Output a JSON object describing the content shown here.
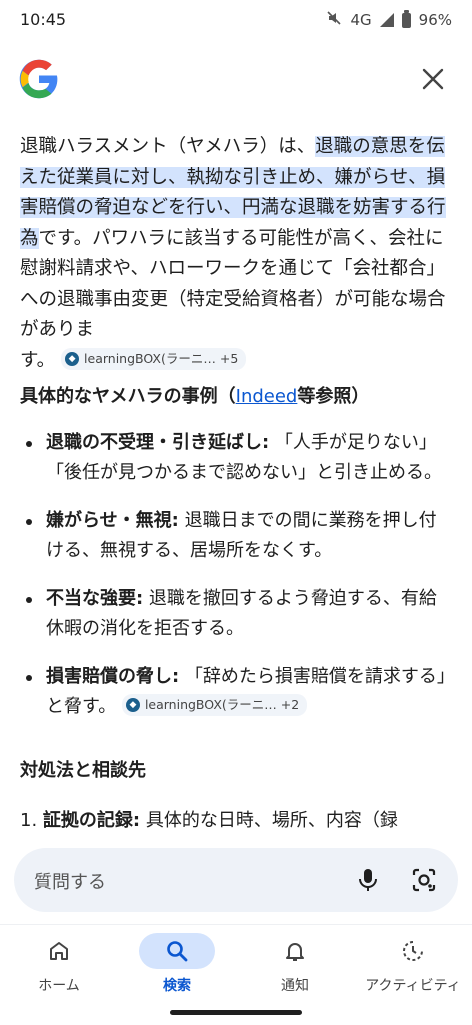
{
  "status": {
    "time": "10:45",
    "network": "4G",
    "battery": "96%"
  },
  "header": {
    "logo": "google-g-icon",
    "close": "close-icon"
  },
  "answer": {
    "p1_before": "退職ハラスメント（ヤメハラ）は、",
    "p1_highlight": "退職の意思を伝えた従業員に対し、執拗な引き止め、嫌がらせ、損害賠償の脅迫などを行い、円満な退職を妨害する行為",
    "p1_after": "です。パワハラに該当する可能性が高く、会社に慰謝料請求や、ハローワークを通じて「会社都合」への退職事由変更（特定受給資格者）が可能な場合がありま",
    "p1_end": "す。",
    "chip1": "learningBOX(ラーニ…  +5",
    "section1_title": "具体的なヤメハラの事例（",
    "section1_link": "Indeed",
    "section1_tail": "等参照）",
    "bullets": [
      {
        "bold": "退職の不受理・引き延ばし:",
        "text": " 「人手が足りない」「後任が見つかるまで認めない」と引き止める。"
      },
      {
        "bold": "嫌がらせ・無視:",
        "text": " 退職日までの間に業務を押し付ける、無視する、居場所をなくす。"
      },
      {
        "bold": "不当な強要:",
        "text": " 退職を撤回するよう脅迫する、有給休暇の消化を拒否する。"
      },
      {
        "bold": "損害賠償の脅し:",
        "text": " 「辞めたら損害賠償を請求する」と脅す。"
      }
    ],
    "chip2": "learningBOX(ラーニ…  +2",
    "section2_title": "対処法と相談先",
    "ordered": [
      {
        "num": "1.",
        "bold": "証拠の記録:",
        "text": " 具体的な日時、場所、内容（録"
      }
    ]
  },
  "search": {
    "placeholder": "質問する",
    "mic": "mic-icon",
    "lens": "lens-icon"
  },
  "nav": [
    {
      "label": "ホーム",
      "icon": "home-icon"
    },
    {
      "label": "検索",
      "icon": "search-icon",
      "active": true
    },
    {
      "label": "通知",
      "icon": "bell-icon"
    },
    {
      "label": "アクティビティ",
      "icon": "activity-icon"
    }
  ],
  "colors": {
    "accent": "#0b57d0",
    "highlight": "#d3e3fd",
    "chip_bg": "#f0f4f9",
    "search_bg": "#eef2f8"
  }
}
